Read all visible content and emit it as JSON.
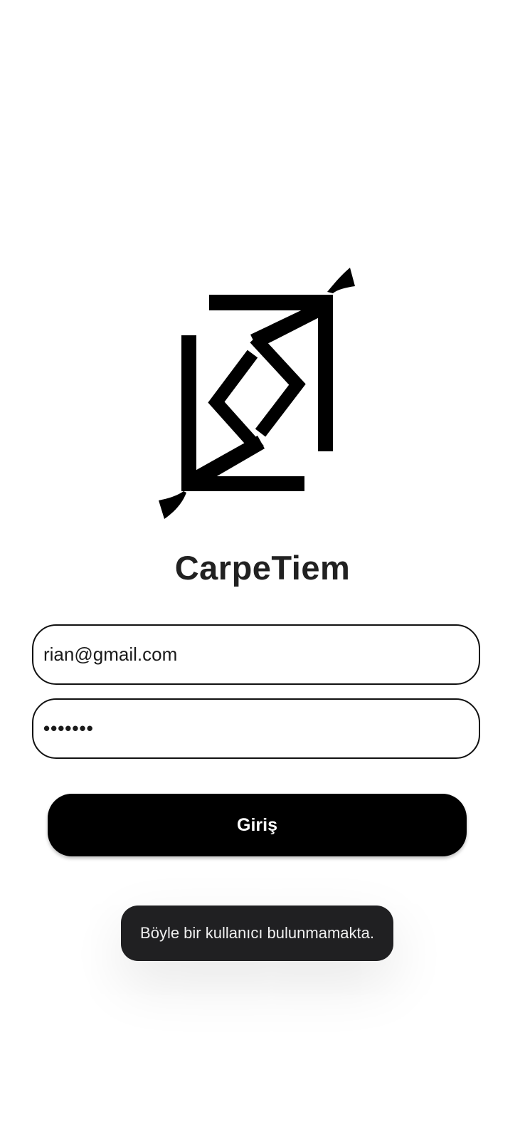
{
  "app": {
    "title": "CarpeTiem",
    "logo": "carpetiem-logo"
  },
  "login_form": {
    "email": {
      "value": "rian@gmail.com",
      "icon": "none"
    },
    "password": {
      "value": "•••••••"
    },
    "submit_label": "Giriş"
  },
  "toast": {
    "message": "Böyle bir kullanıcı bulunmamakta."
  },
  "colors": {
    "background": "#ffffff",
    "text": "#212121",
    "button": "#000000",
    "button_text": "#ffffff",
    "toast_background": "#202022",
    "toast_text": "#f0f0f0"
  }
}
